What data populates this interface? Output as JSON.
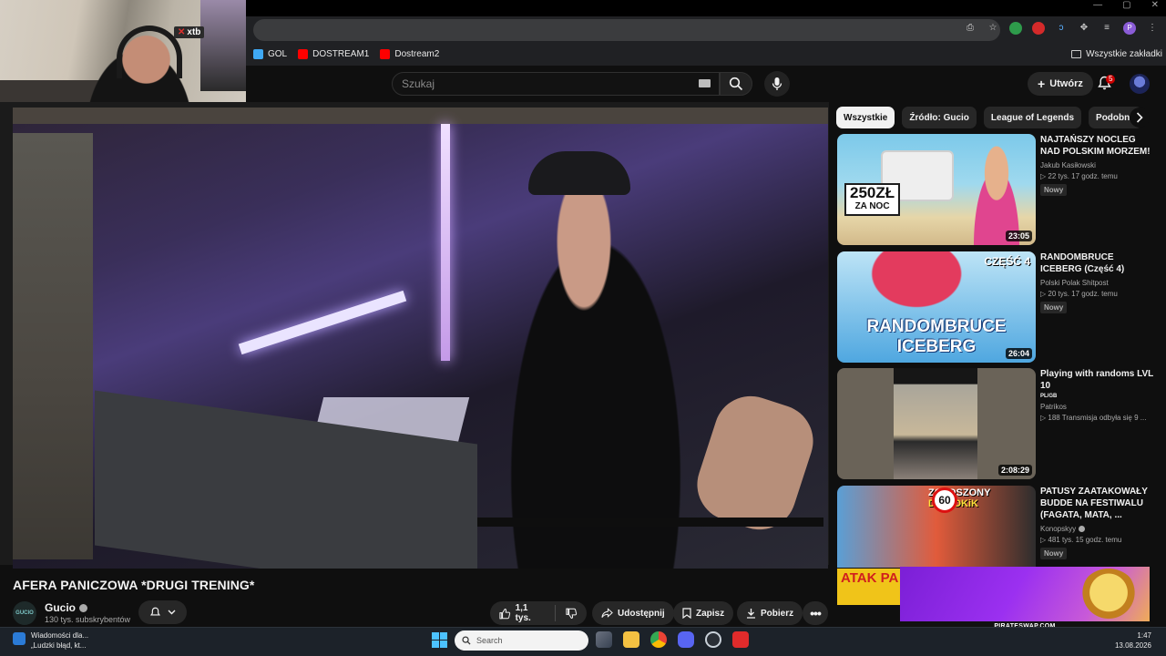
{
  "browser": {
    "window_controls": [
      "—",
      "▢",
      "✕"
    ],
    "bookmarks": [
      {
        "label": "GOL",
        "color": "#3fa9f5"
      },
      {
        "label": "DOSTREAM1",
        "color": "#ff0000"
      },
      {
        "label": "Dostream2",
        "color": "#ff0000"
      }
    ],
    "all_bookmarks_label": "Wszystkie zakładki",
    "profile_initial": "P"
  },
  "overlay": {
    "sponsor_logo": "xtb"
  },
  "youtube": {
    "search": {
      "placeholder": "Szukaj"
    },
    "create_label": "Utwórz",
    "notification_count": "5",
    "video": {
      "title": "AFERA PANICZOWA *DRUGI TRENING*",
      "channel": "Gucio",
      "channel_avatar_text": "GUCIO",
      "subscribers": "130 tys. subskrybentów",
      "likes": "1,1 tys.",
      "share_label": "Udostępnij",
      "save_label": "Zapisz",
      "download_label": "Pobierz"
    },
    "chips": [
      "Wszystkie",
      "Źródło: Gucio",
      "League of Legends",
      "Podobne"
    ],
    "recommendations": [
      {
        "title": "NAJTAŃSZY NOCLEG NAD POLSKIM MORZEM!",
        "channel": "Jakub Kasiłowski",
        "meta": "▷ 22 tys.  17 godz. temu",
        "badge": "Nowy",
        "duration": "23:05",
        "thumb_text": [
          "250ZŁ",
          "ZA NOC"
        ]
      },
      {
        "title": "RANDOMBRUCE ICEBERG (Część 4)",
        "channel": "Polski Polak Shitpost",
        "meta": "▷ 20 tys.  17 godz. temu",
        "badge": "Nowy",
        "duration": "26:04",
        "thumb_text": [
          "CZĘŚĆ 4",
          "RANDOMBRUCE",
          "ICEBERG"
        ]
      },
      {
        "title": "Playing with randoms LVL 10",
        "tag": "PL/GB",
        "channel": "Patrikos",
        "meta": "▷ 188  Transmisja odbyła się 9 ...",
        "duration": "2:08:29"
      },
      {
        "title": "PATUSY ZAATAKOWAŁY BUDDE NA FESTIWALU (FAGATA, MATA, ...",
        "channel": "Konopskyy",
        "meta": "▷ 481 tys.  15 godz. temu",
        "badge": "Nowy",
        "thumb_text": [
          "ZGŁOSZONY",
          "DO UOKiK",
          "60"
        ]
      }
    ],
    "partial_thumb_text": "ATAK PA NA FES",
    "ad_label": "PIRATESWAP.COM"
  },
  "taskbar": {
    "news_title": "Wiadomości dla...",
    "news_text": "„Ludzki błąd, kt...",
    "search_placeholder": "Search",
    "time": "1:47",
    "date": "13.08.2026"
  },
  "colors": {
    "yt_bg": "#0f0f0f",
    "chip_bg": "#272727",
    "accent_red": "#ff0000",
    "taskbar_bg": "#1c2229"
  }
}
